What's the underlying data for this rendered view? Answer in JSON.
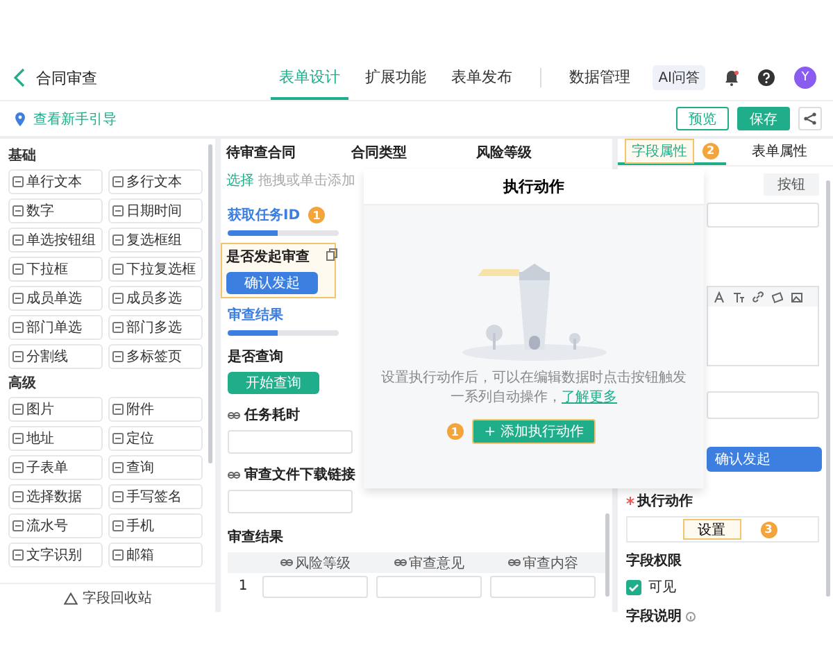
{
  "header": {
    "title": "合同审查",
    "tabs": [
      {
        "label": "表单设计",
        "selected": true
      },
      {
        "label": "扩展功能",
        "selected": false
      },
      {
        "label": "表单发布",
        "selected": false
      },
      {
        "label": "数据管理",
        "selected": false
      }
    ],
    "ai_button": "AI问答",
    "avatar": "Y"
  },
  "toolbar": {
    "guide_link": "查看新手引导",
    "buttons": [
      {
        "label": "预览",
        "kind": "outline"
      },
      {
        "label": "保存",
        "kind": "primary"
      }
    ]
  },
  "palette": {
    "groups": [
      {
        "title": "基础",
        "items": [
          "单行文本",
          "多行文本",
          "数字",
          "日期时间",
          "单选按钮组",
          "复选框组",
          "下拉框",
          "下拉复选框",
          "成员单选",
          "成员多选",
          "部门单选",
          "部门多选",
          "分割线",
          "多标签页"
        ]
      },
      {
        "title": "高级",
        "items": [
          "图片",
          "附件",
          "地址",
          "定位",
          "子表单",
          "查询",
          "选择数据",
          "手写签名",
          "流水号",
          "手机",
          "文字识别",
          "邮箱"
        ]
      }
    ],
    "recycle_bin": "字段回收站"
  },
  "canvas": {
    "columns": [
      "待审查合同",
      "合同类型",
      "风险等级"
    ],
    "select_link": "选择",
    "select_hint": "拖拽或单击添加",
    "fields": [
      {
        "kind": "section",
        "label": "获取任务ID",
        "badge": "1",
        "selected": false
      },
      {
        "kind": "button",
        "label": "是否发起审查",
        "button": "确认发起",
        "color": "#3d7fe0",
        "selected": true
      },
      {
        "kind": "section",
        "label": "审查结果",
        "selected": false
      },
      {
        "kind": "button",
        "label": "是否查询",
        "button": "开始查询",
        "color": "#1fad8a",
        "selected": false
      },
      {
        "kind": "input",
        "label": "任务耗时",
        "linked": true,
        "selected": false
      },
      {
        "kind": "input",
        "label": "审查文件下载链接",
        "linked": true,
        "selected": false
      },
      {
        "kind": "subtable",
        "label": "审查结果",
        "columns": [
          "风险等级",
          "审查意见",
          "审查内容"
        ],
        "rows": [
          "1"
        ],
        "selected": false
      }
    ]
  },
  "modal": {
    "title": "执行动作",
    "description": "设置执行动作后，可以在编辑数据时点击按钮触发一系列自动操作，",
    "link": "了解更多",
    "badge": "1",
    "add_button": "+ 添加执行动作"
  },
  "props": {
    "tabs": [
      {
        "label": "字段属性",
        "selected": true,
        "badge": "2"
      },
      {
        "label": "表单属性",
        "selected": false
      }
    ],
    "segment": "按钮",
    "preview_button": "确认发起",
    "action_required": true,
    "action_label": "执行动作",
    "settings_button": "设置",
    "settings_badge": "3",
    "permission_title": "字段权限",
    "permissions": [
      {
        "label": "可见",
        "checked": true
      }
    ],
    "description_title": "字段说明"
  }
}
